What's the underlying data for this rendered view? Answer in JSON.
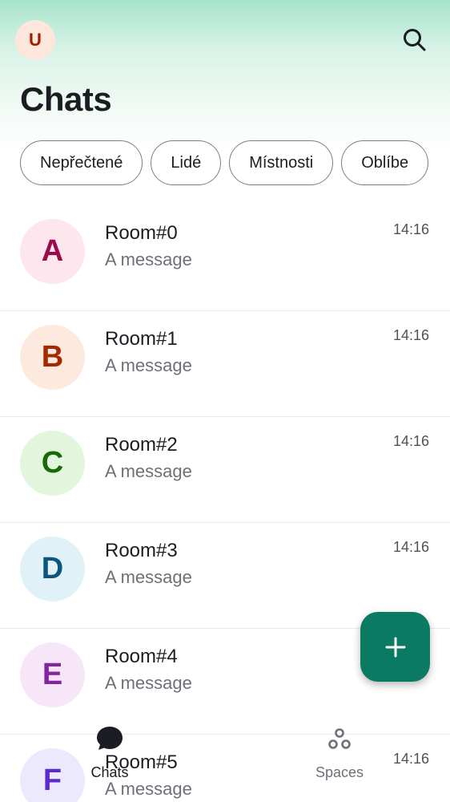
{
  "header": {
    "user_avatar_initial": "U",
    "title": "Chats",
    "search_icon": "search-icon"
  },
  "filters": [
    {
      "label": "Nepřečtené"
    },
    {
      "label": "Lidé"
    },
    {
      "label": "Místnosti"
    },
    {
      "label": "Oblíbe"
    }
  ],
  "rooms": [
    {
      "initial": "A",
      "name": "Room#0",
      "message": "A message",
      "time": "14:16",
      "avatar_bg": "#fde6ee",
      "avatar_fg": "#9b0a4a"
    },
    {
      "initial": "B",
      "name": "Room#1",
      "message": "A message",
      "time": "14:16",
      "avatar_bg": "#fde9dd",
      "avatar_fg": "#a32a00"
    },
    {
      "initial": "C",
      "name": "Room#2",
      "message": "A message",
      "time": "14:16",
      "avatar_bg": "#e1f6dc",
      "avatar_fg": "#186a06"
    },
    {
      "initial": "D",
      "name": "Room#3",
      "message": "A message",
      "time": "14:16",
      "avatar_bg": "#e0f2f8",
      "avatar_fg": "#0b557e"
    },
    {
      "initial": "E",
      "name": "Room#4",
      "message": "A message",
      "time": "",
      "avatar_bg": "#f6e6f7",
      "avatar_fg": "#8424a0"
    },
    {
      "initial": "F",
      "name": "Room#5",
      "message": "A message",
      "time": "14:16",
      "avatar_bg": "#ece8fd",
      "avatar_fg": "#5b2ac9"
    }
  ],
  "fab": {
    "icon": "plus-icon",
    "color": "#0a7b62"
  },
  "bottom_nav": {
    "chats_label": "Chats",
    "spaces_label": "Spaces"
  }
}
